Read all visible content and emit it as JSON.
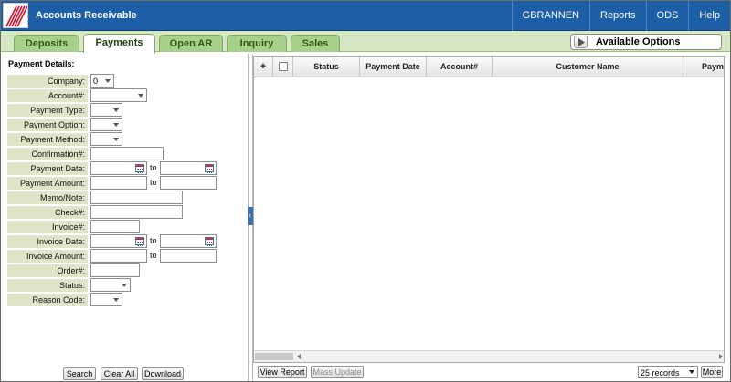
{
  "header": {
    "title": "Accounts Receivable",
    "nav": [
      "GBRANNEN",
      "Reports",
      "ODS",
      "Help"
    ]
  },
  "tabs": [
    "Deposits",
    "Payments",
    "Open AR",
    "Inquiry",
    "Sales"
  ],
  "active_tab": "Payments",
  "available_options": "Available Options",
  "form": {
    "title": "Payment Details:",
    "company": {
      "label": "Company:",
      "value": "0"
    },
    "account": {
      "label": "Account#:"
    },
    "payment_type": {
      "label": "Payment Type:"
    },
    "payment_option": {
      "label": "Payment Option:"
    },
    "payment_method": {
      "label": "Payment Method:"
    },
    "confirmation": {
      "label": "Confirmation#:"
    },
    "payment_date": {
      "label": "Payment Date:",
      "to": "to"
    },
    "payment_amount": {
      "label": "Payment Amount:",
      "to": "to"
    },
    "memo": {
      "label": "Memo/Note:"
    },
    "check": {
      "label": "Check#:"
    },
    "invoice": {
      "label": "Invoice#:"
    },
    "invoice_date": {
      "label": "Invoice Date:",
      "to": "to"
    },
    "invoice_amount": {
      "label": "Invoice Amount:",
      "to": "to"
    },
    "order": {
      "label": "Order#:"
    },
    "status": {
      "label": "Status:"
    },
    "reason_code": {
      "label": "Reason Code:"
    }
  },
  "form_buttons": {
    "search": "Search",
    "clear_all": "Clear All",
    "download": "Download"
  },
  "grid": {
    "columns": [
      "+",
      "",
      "Status",
      "Payment Date",
      "Account#",
      "Customer Name",
      "Paym"
    ]
  },
  "grid_footer": {
    "view_report": "View Report",
    "mass_update": "Mass Update",
    "records": "25 records",
    "more": "More"
  },
  "colors": {
    "header_blue": "#1c5fa6",
    "tab_green": "#a8d08d",
    "tabbar_bg": "#d6e8c3",
    "label_bg": "#dfe5c8"
  }
}
